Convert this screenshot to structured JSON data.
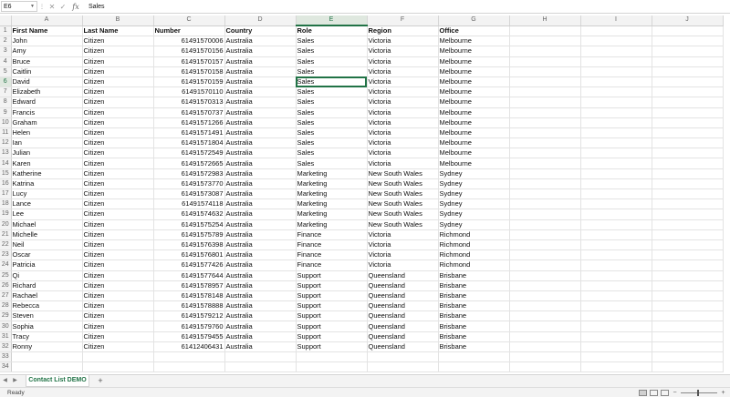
{
  "formula_bar": {
    "name_box": "E6",
    "cancel_glyph": "✕",
    "confirm_glyph": "✓",
    "fx_label": "fx",
    "value": "Sales"
  },
  "columns": [
    "A",
    "B",
    "C",
    "D",
    "E",
    "F",
    "G",
    "H",
    "I",
    "J"
  ],
  "header_row": [
    "First Name",
    "Last Name",
    "Number",
    "Country",
    "Role",
    "Region",
    "Office"
  ],
  "rows": [
    [
      "John",
      "Citizen",
      "61491570006",
      "Australia",
      "Sales",
      "Victoria",
      "Melbourne"
    ],
    [
      "Amy",
      "Citizen",
      "61491570156",
      "Australia",
      "Sales",
      "Victoria",
      "Melbourne"
    ],
    [
      "Bruce",
      "Citizen",
      "61491570157",
      "Australia",
      "Sales",
      "Victoria",
      "Melbourne"
    ],
    [
      "Caitlin",
      "Citizen",
      "61491570158",
      "Australia",
      "Sales",
      "Victoria",
      "Melbourne"
    ],
    [
      "David",
      "Citizen",
      "61491570159",
      "Australia",
      "Sales",
      "Victoria",
      "Melbourne"
    ],
    [
      "Elizabeth",
      "Citizen",
      "61491570110",
      "Australia",
      "Sales",
      "Victoria",
      "Melbourne"
    ],
    [
      "Edward",
      "Citizen",
      "61491570313",
      "Australia",
      "Sales",
      "Victoria",
      "Melbourne"
    ],
    [
      "Francis",
      "Citizen",
      "61491570737",
      "Australia",
      "Sales",
      "Victoria",
      "Melbourne"
    ],
    [
      "Graham",
      "Citizen",
      "61491571266",
      "Australia",
      "Sales",
      "Victoria",
      "Melbourne"
    ],
    [
      "Helen",
      "Citizen",
      "61491571491",
      "Australia",
      "Sales",
      "Victoria",
      "Melbourne"
    ],
    [
      "Ian",
      "Citizen",
      "61491571804",
      "Australia",
      "Sales",
      "Victoria",
      "Melbourne"
    ],
    [
      "Julian",
      "Citizen",
      "61491572549",
      "Australia",
      "Sales",
      "Victoria",
      "Melbourne"
    ],
    [
      "Karen",
      "Citizen",
      "61491572665",
      "Australia",
      "Sales",
      "Victoria",
      "Melbourne"
    ],
    [
      "Katherine",
      "Citizen",
      "61491572983",
      "Australia",
      "Marketing",
      "New South Wales",
      "Sydney"
    ],
    [
      "Katrina",
      "Citizen",
      "61491573770",
      "Australia",
      "Marketing",
      "New South Wales",
      "Sydney"
    ],
    [
      "Lucy",
      "Citizen",
      "61491573087",
      "Australia",
      "Marketing",
      "New South Wales",
      "Sydney"
    ],
    [
      "Lance",
      "Citizen",
      "61491574118",
      "Australia",
      "Marketing",
      "New South Wales",
      "Sydney"
    ],
    [
      "Lee",
      "Citizen",
      "61491574632",
      "Australia",
      "Marketing",
      "New South Wales",
      "Sydney"
    ],
    [
      "Michael",
      "Citizen",
      "61491575254",
      "Australia",
      "Marketing",
      "New South Wales",
      "Sydney"
    ],
    [
      "Michelle",
      "Citizen",
      "61491575789",
      "Australia",
      "Finance",
      "Victoria",
      "Richmond"
    ],
    [
      "Neil",
      "Citizen",
      "61491576398",
      "Australia",
      "Finance",
      "Victoria",
      "Richmond"
    ],
    [
      "Oscar",
      "Citizen",
      "61491576801",
      "Australia",
      "Finance",
      "Victoria",
      "Richmond"
    ],
    [
      "Patricia",
      "Citizen",
      "61491577426",
      "Australia",
      "Finance",
      "Victoria",
      "Richmond"
    ],
    [
      "Qi",
      "Citizen",
      "61491577644",
      "Australia",
      "Support",
      "Queensland",
      "Brisbane"
    ],
    [
      "Richard",
      "Citizen",
      "61491578957",
      "Australia",
      "Support",
      "Queensland",
      "Brisbane"
    ],
    [
      "Rachael",
      "Citizen",
      "61491578148",
      "Australia",
      "Support",
      "Queensland",
      "Brisbane"
    ],
    [
      "Rebecca",
      "Citizen",
      "61491578888",
      "Australia",
      "Support",
      "Queensland",
      "Brisbane"
    ],
    [
      "Steven",
      "Citizen",
      "61491579212",
      "Australia",
      "Support",
      "Queensland",
      "Brisbane"
    ],
    [
      "Sophia",
      "Citizen",
      "61491579760",
      "Australia",
      "Support",
      "Queensland",
      "Brisbane"
    ],
    [
      "Tracy",
      "Citizen",
      "61491579455",
      "Australia",
      "Support",
      "Queensland",
      "Brisbane"
    ],
    [
      "Ronny",
      "Citizen",
      "61412406431",
      "Australia",
      "Support",
      "Queensland",
      "Brisbane"
    ]
  ],
  "blank_rows": [
    33,
    34
  ],
  "sheet_tab": "Contact List DEMO",
  "status": "Ready",
  "colors": {
    "accent": "#217346"
  }
}
